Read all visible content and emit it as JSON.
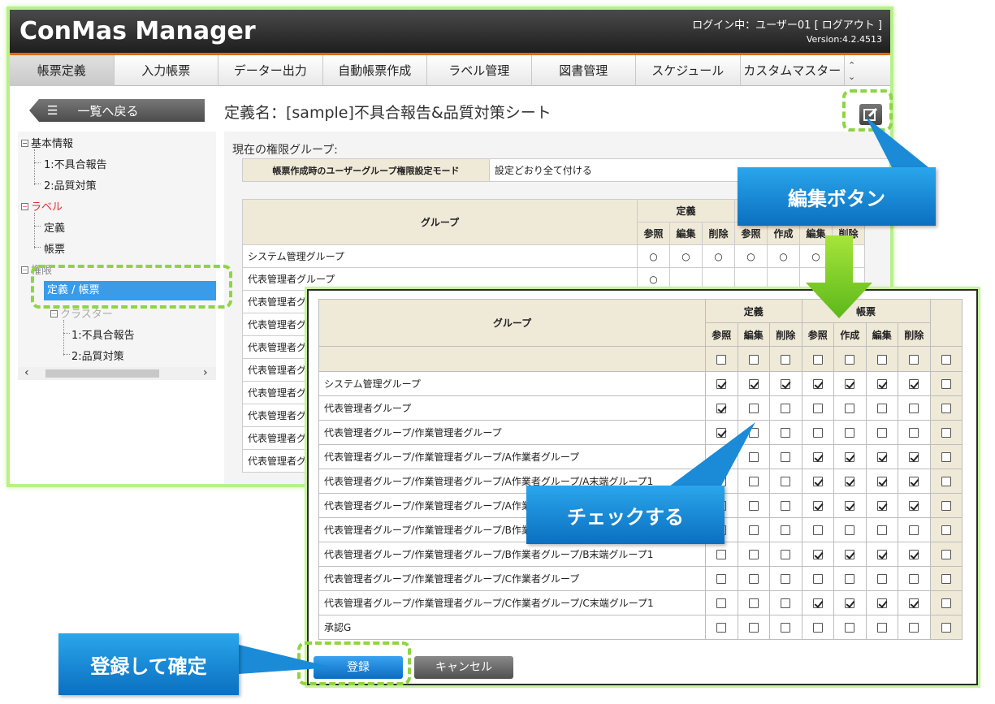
{
  "app": {
    "title": "ConMas Manager",
    "login_info": "ログイン中：ユーザー01 [ ログアウト ]",
    "version": "Version:4.2.4513"
  },
  "menu": [
    "帳票定義",
    "入力帳票",
    "データー出力",
    "自動帳票作成",
    "ラベル管理",
    "図書管理",
    "スケジュール",
    "カスタムマスター"
  ],
  "sidebar": {
    "back_label": "一覧へ戻る",
    "tree": {
      "basic": "基本情報",
      "basic_1": "1:不具合報告",
      "basic_2": "2:品質対策",
      "label": "ラベル",
      "label_def": "定義",
      "label_form": "帳票",
      "perm": "権限",
      "perm_selected": "定義 / 帳票",
      "cluster": "クラスター",
      "cluster_1": "1:不具合報告",
      "cluster_2": "2:品質対策"
    }
  },
  "definition_title": "定義名：[sample]不具合報告&品質対策シート",
  "current_group_label": "現在の権限グループ:",
  "mode": {
    "header": "帳票作成時のユーザーグループ権限設定モード",
    "value": "設定どおり全て付ける"
  },
  "bg_table": {
    "group_header": "グループ",
    "def_header": "定義",
    "sub": [
      "参照",
      "編集",
      "削除",
      "参照",
      "作成",
      "編集",
      "削除"
    ],
    "rows": [
      {
        "name": "システム管理グループ",
        "marks": [
          "○",
          "○",
          "○",
          "○",
          "○",
          "○",
          ""
        ]
      },
      {
        "name": "代表管理者グループ",
        "marks": [
          "○",
          "",
          "",
          "",
          "",
          "",
          ""
        ]
      },
      {
        "name": "代表管理者グル",
        "marks": [
          "",
          "",
          "",
          "",
          "",
          "",
          ""
        ]
      },
      {
        "name": "代表管理者グル",
        "marks": [
          "",
          "",
          "",
          "",
          "",
          "",
          ""
        ]
      },
      {
        "name": "代表管理者グル",
        "marks": [
          "",
          "",
          "",
          "",
          "",
          "",
          ""
        ]
      },
      {
        "name": "代表管理者グル",
        "marks": [
          "",
          "",
          "",
          "",
          "",
          "",
          ""
        ]
      },
      {
        "name": "代表管理者グル",
        "marks": [
          "",
          "",
          "",
          "",
          "",
          "",
          ""
        ]
      },
      {
        "name": "代表管理者グル",
        "marks": [
          "",
          "",
          "",
          "",
          "",
          "",
          ""
        ]
      },
      {
        "name": "代表管理者グル",
        "marks": [
          "",
          "",
          "",
          "",
          "",
          "",
          ""
        ]
      },
      {
        "name": "代表管理者グル",
        "marks": [
          "",
          "",
          "",
          "",
          "",
          "",
          ""
        ]
      }
    ]
  },
  "perm_table": {
    "group_header": "グループ",
    "def_header": "定義",
    "form_header": "帳票",
    "sub": [
      "参照",
      "編集",
      "削除",
      "参照",
      "作成",
      "編集",
      "削除"
    ],
    "rows": [
      {
        "name": "システム管理グループ",
        "checks": [
          1,
          1,
          1,
          1,
          1,
          1,
          1,
          0
        ]
      },
      {
        "name": "代表管理者グループ",
        "checks": [
          1,
          0,
          0,
          0,
          0,
          0,
          0,
          0
        ]
      },
      {
        "name": "代表管理者グループ/作業管理者グループ",
        "checks": [
          1,
          0,
          0,
          0,
          0,
          0,
          0,
          0
        ]
      },
      {
        "name": "代表管理者グループ/作業管理者グループ/A作業者グループ",
        "checks": [
          0,
          0,
          0,
          1,
          1,
          1,
          1,
          0
        ]
      },
      {
        "name": "代表管理者グループ/作業管理者グループ/A作業者グループ/A末端グループ1",
        "checks": [
          0,
          0,
          0,
          1,
          1,
          1,
          1,
          0
        ]
      },
      {
        "name": "代表管理者グループ/作業管理者グループ/A作業者グループ/A末端グループ2",
        "checks": [
          0,
          0,
          0,
          1,
          1,
          1,
          1,
          0
        ]
      },
      {
        "name": "代表管理者グループ/作業管理者グループ/B作業者グループ",
        "checks": [
          0,
          0,
          0,
          0,
          0,
          0,
          0,
          0
        ]
      },
      {
        "name": "代表管理者グループ/作業管理者グループ/B作業者グループ/B末端グループ1",
        "checks": [
          0,
          0,
          0,
          1,
          1,
          1,
          1,
          0
        ]
      },
      {
        "name": "代表管理者グループ/作業管理者グループ/C作業者グループ",
        "checks": [
          0,
          0,
          0,
          0,
          0,
          0,
          0,
          0
        ]
      },
      {
        "name": "代表管理者グループ/作業管理者グループ/C作業者グループ/C末端グループ1",
        "checks": [
          0,
          0,
          0,
          1,
          1,
          1,
          1,
          0
        ]
      },
      {
        "name": "承認G",
        "checks": [
          0,
          0,
          0,
          0,
          0,
          0,
          0,
          0
        ]
      }
    ]
  },
  "buttons": {
    "register": "登録",
    "cancel": "キャンセル"
  },
  "callouts": {
    "edit": "編集ボタン",
    "check": "チェックする",
    "register": "登録して確定"
  },
  "colors": {
    "accent": "#e46a10",
    "callout": "#0b6fc0",
    "highlight": "#8fd442",
    "selected": "#3a9be8"
  }
}
